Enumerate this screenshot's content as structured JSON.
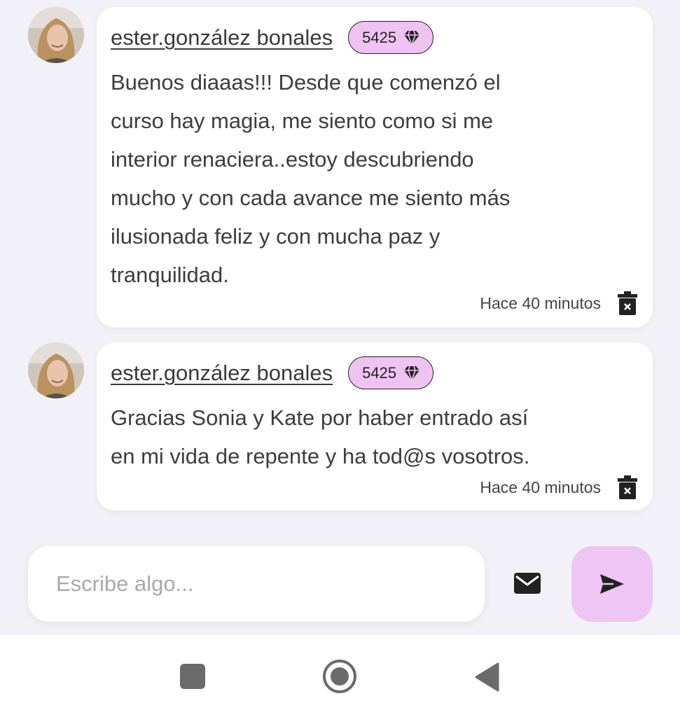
{
  "messages": [
    {
      "username": "ester.gonzález bonales",
      "points": "5425",
      "text": "Buenos diaaas!!! Desde que comenzó el\ncurso hay magia, me siento como si me\ninterior renaciera..estoy descubriendo\nmucho y con cada avance me siento más\nilusionada feliz y con mucha paz y\ntranquilidad.",
      "time": "Hace 40 minutos"
    },
    {
      "username": "ester.gonzález bonales",
      "points": "5425",
      "text": "Gracias Sonia y Kate por haber entrado así\nen mi vida de repente y ha tod@s vosotros.",
      "time": "Hace 40 minutos"
    }
  ],
  "composer": {
    "placeholder": "Escribe algo...",
    "mail_icon": "envelope-icon",
    "send_icon": "send-arrow-icon"
  },
  "navbar": {
    "recents_icon": "square-icon",
    "home_icon": "circle-home-icon",
    "back_icon": "triangle-back-icon"
  },
  "colors": {
    "background": "#f1f1f7",
    "badge": "#eec3f2",
    "send_button": "#efc5f3",
    "card": "#ffffff"
  }
}
